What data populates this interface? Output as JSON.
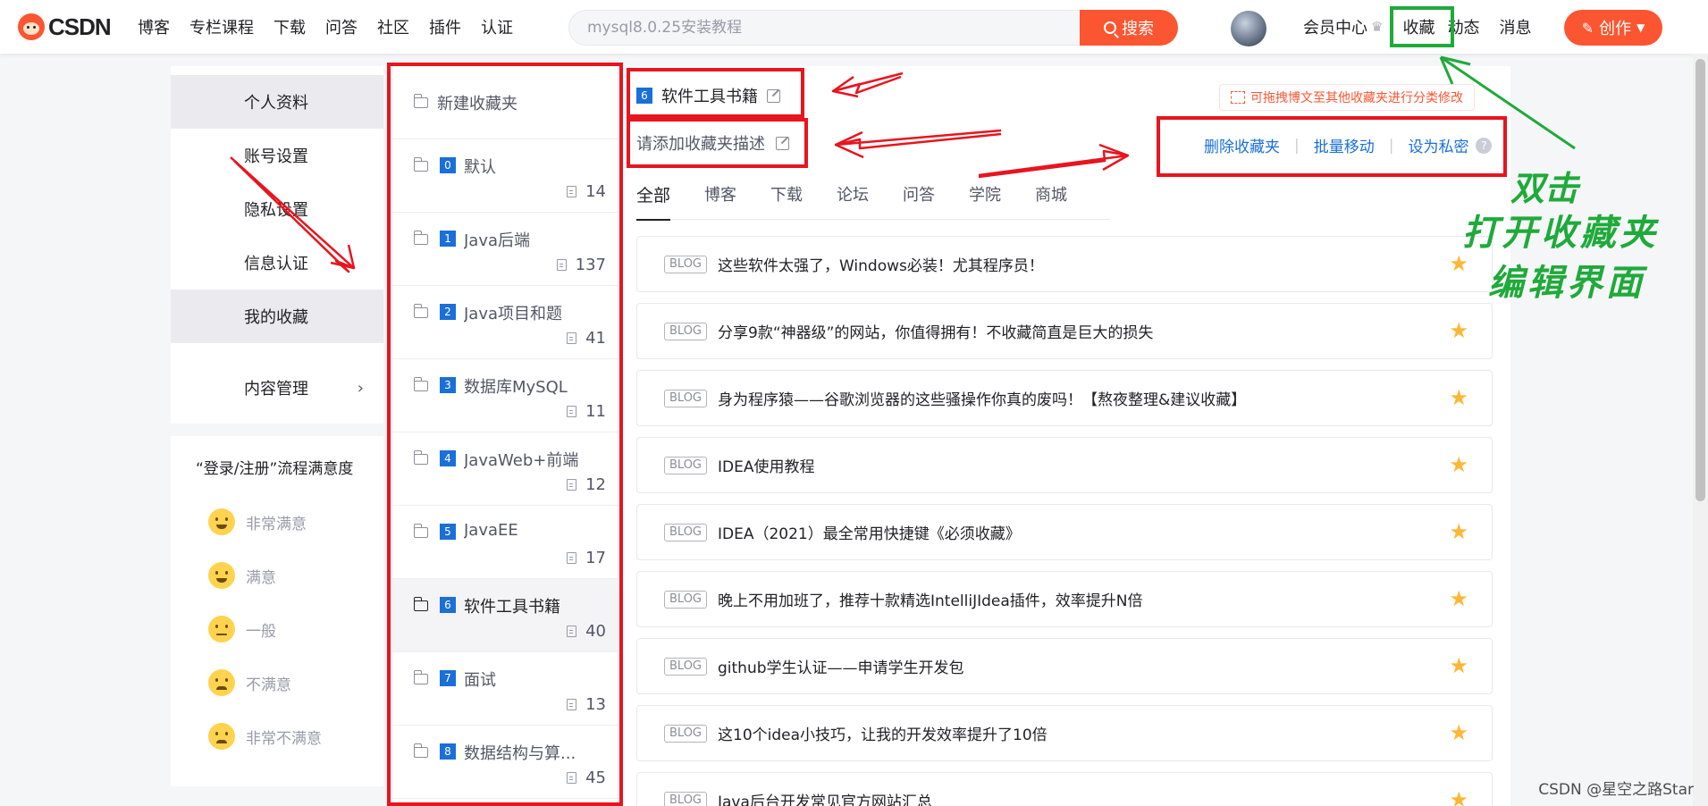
{
  "header": {
    "logo_text": "CSDN",
    "nav": [
      "博客",
      "专栏课程",
      "下载",
      "问答",
      "社区",
      "插件",
      "认证"
    ],
    "search_placeholder": "mysql8.0.25安装教程",
    "search_button": "搜索",
    "vip": "会员中心",
    "favorites": "收藏",
    "dynamics": "动态",
    "messages": "消息",
    "create": "创作"
  },
  "left_menu": {
    "items": [
      {
        "label": "个人资料"
      },
      {
        "label": "账号设置"
      },
      {
        "label": "隐私设置"
      },
      {
        "label": "信息认证"
      },
      {
        "label": "我的收藏"
      },
      {
        "label": "内容管理"
      }
    ]
  },
  "survey": {
    "title": "“登录/注册”流程满意度",
    "options": [
      "非常满意",
      "满意",
      "一般",
      "不满意",
      "非常不满意"
    ]
  },
  "folders": {
    "new_label": "新建收藏夹",
    "items": [
      {
        "index": "0",
        "name": "默认",
        "count": "14"
      },
      {
        "index": "1",
        "name": "Java后端",
        "count": "137"
      },
      {
        "index": "2",
        "name": "Java项目和题",
        "count": "41"
      },
      {
        "index": "3",
        "name": "数据库MySQL",
        "count": "11"
      },
      {
        "index": "4",
        "name": "JavaWeb+前端",
        "count": "12"
      },
      {
        "index": "5",
        "name": "JavaEE",
        "count": "17"
      },
      {
        "index": "6",
        "name": "软件工具书籍",
        "count": "40"
      },
      {
        "index": "7",
        "name": "面试",
        "count": "13"
      },
      {
        "index": "8",
        "name": "数据结构与算...",
        "count": "45"
      }
    ]
  },
  "main": {
    "folder_index": "6",
    "folder_title": "软件工具书籍",
    "description_placeholder": "请添加收藏夹描述",
    "drag_tip": "可拖拽博文至其他收藏夹进行分类修改",
    "actions": {
      "delete": "删除收藏夹",
      "move": "批量移动",
      "private": "设为私密",
      "help": "?"
    },
    "tabs": [
      "全部",
      "博客",
      "下载",
      "论坛",
      "问答",
      "学院",
      "商城"
    ],
    "articles": [
      {
        "tag": "BLOG",
        "title": "这些软件太强了，Windows必装！尤其程序员！"
      },
      {
        "tag": "BLOG",
        "title": "分享9款“神器级”的网站，你值得拥有！不收藏简直是巨大的损失"
      },
      {
        "tag": "BLOG",
        "title": "身为程序猿——谷歌浏览器的这些骚操作你真的废吗！【熬夜整理&建议收藏】"
      },
      {
        "tag": "BLOG",
        "title": "IDEA使用教程"
      },
      {
        "tag": "BLOG",
        "title": "IDEA（2021）最全常用快捷键《必须收藏》"
      },
      {
        "tag": "BLOG",
        "title": "晚上不用加班了，推荐十款精选IntelliJIdea插件，效率提升N倍"
      },
      {
        "tag": "BLOG",
        "title": "github学生认证——申请学生开发包"
      },
      {
        "tag": "BLOG",
        "title": "这10个idea小技巧，让我的开发效率提升了10倍"
      },
      {
        "tag": "BLOG",
        "title": "Java后台开发常见官方网站汇总"
      }
    ]
  },
  "annotation": {
    "line1": "双击",
    "line2": "打开收藏夹",
    "line3": "编辑界面",
    "color_red": "#e8141e",
    "color_green": "#1faa3a"
  },
  "watermark": "CSDN @星空之路Star"
}
